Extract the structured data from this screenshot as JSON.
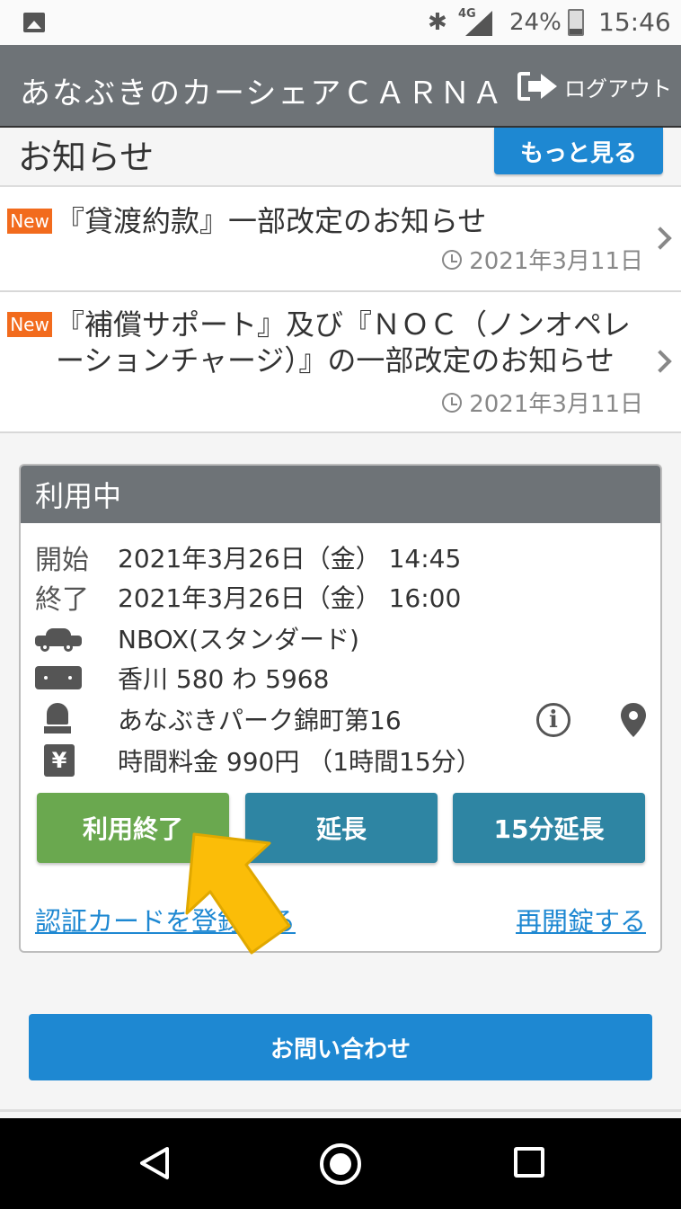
{
  "status_bar": {
    "network": "4G",
    "battery_percent": "24%",
    "time": "15:46",
    "battery_level": 0.24
  },
  "header": {
    "title": "あなぶきのカーシェアＣＡＲＮＡ",
    "logout_label": "ログアウト"
  },
  "notices": {
    "heading": "お知らせ",
    "more_label": "もっと見る",
    "items": [
      {
        "badge": "New",
        "text": "『貸渡約款』一部改定のお知らせ",
        "date": "2021年3月11日"
      },
      {
        "badge": "New",
        "text": "『補償サポート』及び『ＮＯＣ（ノンオペレーションチャージ）』の一部改定のお知らせ",
        "date": "2021年3月11日"
      }
    ]
  },
  "in_use": {
    "heading": "利用中",
    "start_label": "開始",
    "start_value": "2021年3月26日（金） 14:45",
    "end_label": "終了",
    "end_value": "2021年3月26日（金） 16:00",
    "car_model": "NBOX(スタンダード)",
    "plate": "香川 580 わ 5968",
    "station": "あなぶきパーク錦町第16",
    "fee": "時間料金 990円 （1時間15分）",
    "buttons": {
      "end": "利用終了",
      "extend": "延長",
      "extend_15": "15分延長"
    },
    "links": {
      "register_card": "認証カードを登録する",
      "relock": "再開錠する"
    }
  },
  "contact_label": "お問い合わせ",
  "colors": {
    "header": "#6e7377",
    "primary_blue": "#1e88d2",
    "end_green": "#6aa84f",
    "teal": "#2e85a3",
    "new_badge": "#f26b1d",
    "arrow": "#fbbd08"
  }
}
